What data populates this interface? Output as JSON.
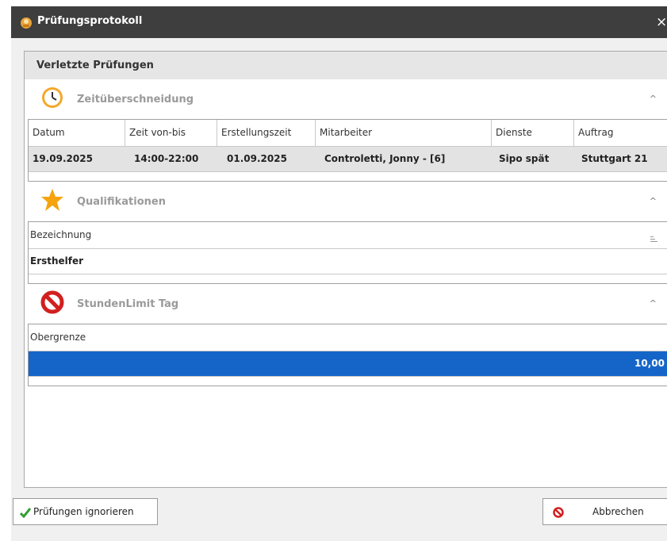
{
  "window": {
    "title": "Prüfungsprotokoll",
    "close_glyph": "×"
  },
  "group": {
    "title": "Verletzte Prüfungen"
  },
  "sections": {
    "time": {
      "title": "Zeitüberschneidung",
      "icon": "clock-icon",
      "caret": "^",
      "columns": [
        "Datum",
        "Zeit von-bis",
        "Erstellungszeit",
        "Mitarbeiter",
        "Dienste",
        "Auftrag"
      ],
      "row": [
        "19.09.2025",
        "14:00-22:00",
        "01.09.2025",
        "Controletti, Jonny - [6]",
        "Sipo spät",
        "Stuttgart 21"
      ]
    },
    "qual": {
      "title": "Qualifikationen",
      "icon": "star-icon",
      "caret": "^",
      "columns": [
        "Bezeichnung"
      ],
      "row": [
        "Ersthelfer"
      ]
    },
    "limit": {
      "title": "StundenLimit Tag",
      "icon": "no-entry-icon",
      "caret": "^",
      "columns": [
        "Obergrenze"
      ],
      "row": [
        "10,00"
      ]
    }
  },
  "buttons": {
    "ignore": "Prüfungen ignorieren",
    "cancel": "Abbrechen"
  },
  "colors": {
    "selection": "#1565c9",
    "titlebar": "#3e3e3e"
  }
}
